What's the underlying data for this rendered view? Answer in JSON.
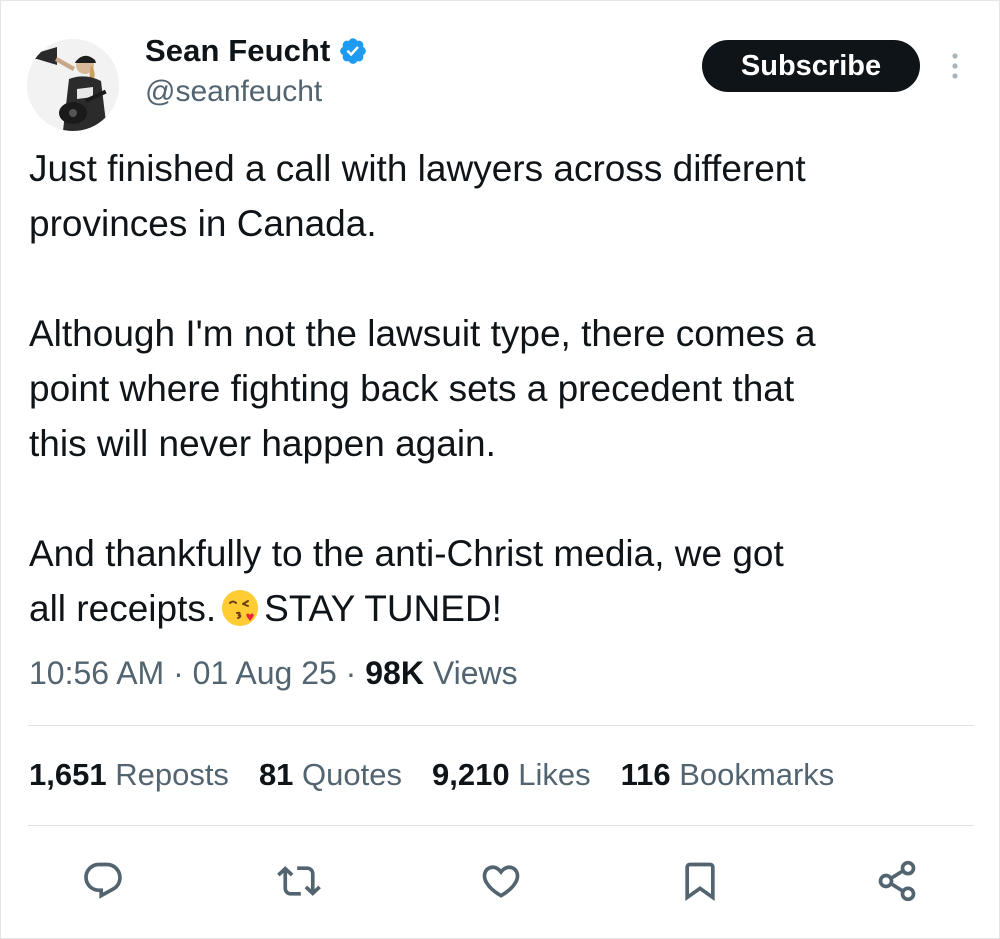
{
  "author": {
    "display_name": "Sean Feucht",
    "handle": "@seanfeucht",
    "verified_icon": "verified-badge-icon",
    "avatar_icon": "avatar-photo"
  },
  "header": {
    "subscribe_label": "Subscribe",
    "more_icon": "more-vertical-icon"
  },
  "tweet": {
    "paragraph_1_line_1": "Just finished a call with lawyers across different",
    "paragraph_1_line_2": "provinces in Canada.",
    "paragraph_2_line_1": "Although I'm not the lawsuit type, there comes a",
    "paragraph_2_line_2": "point where fighting back sets a precedent that",
    "paragraph_2_line_3": "this will never happen again.",
    "paragraph_3_line_1": "And thankfully to the anti-Christ media, we got",
    "paragraph_3_line_2_pre": "all receipts.",
    "paragraph_3_line_2_post": "STAY TUNED!",
    "emoji_icon": "kissing-face-emoji"
  },
  "meta": {
    "time": "10:56 AM",
    "separator": "·",
    "date": "01 Aug 25",
    "views_count": "98K",
    "views_label": "Views"
  },
  "stats": {
    "reposts_count": "1,651",
    "reposts_label": "Reposts",
    "quotes_count": "81",
    "quotes_label": "Quotes",
    "likes_count": "9,210",
    "likes_label": "Likes",
    "bookmarks_count": "116",
    "bookmarks_label": "Bookmarks"
  },
  "actions": [
    {
      "name": "reply",
      "icon": "reply-icon"
    },
    {
      "name": "repost",
      "icon": "repost-icon"
    },
    {
      "name": "like",
      "icon": "heart-icon"
    },
    {
      "name": "bookmark",
      "icon": "bookmark-icon"
    },
    {
      "name": "share",
      "icon": "share-icon"
    }
  ],
  "colors": {
    "text_primary": "#0f1419",
    "text_secondary": "#536471",
    "verified_blue": "#1d9bf0",
    "button_bg": "#0f1419",
    "divider": "#dfe3e6"
  }
}
